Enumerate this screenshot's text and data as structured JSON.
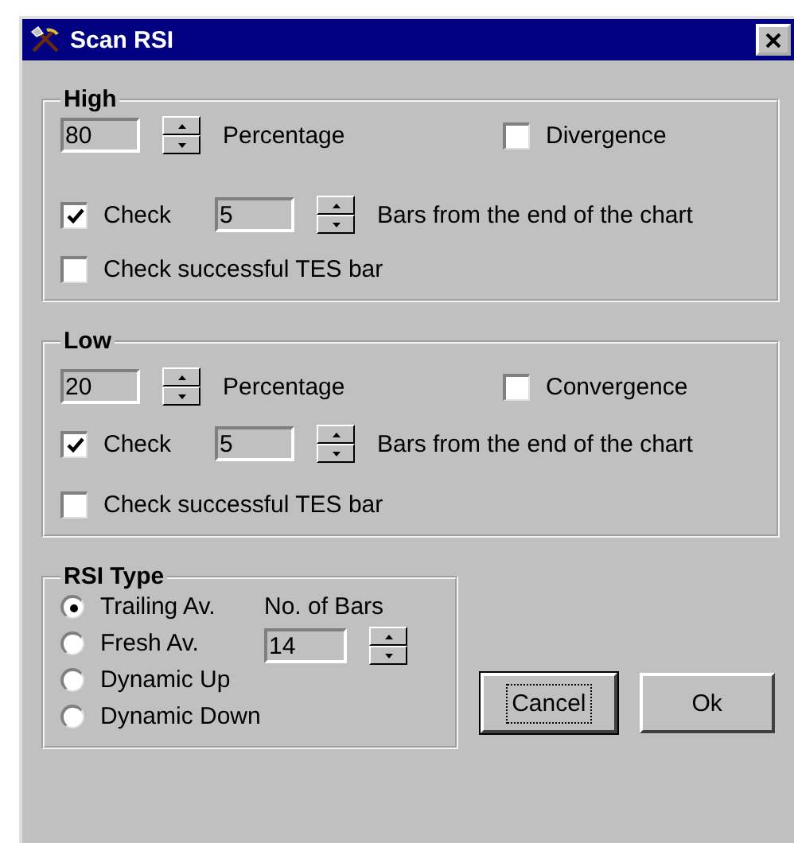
{
  "window": {
    "title": "Scan RSI"
  },
  "groups": [
    {
      "title": "High",
      "percentage": "80",
      "percentage_label": "Percentage",
      "option": {
        "label": "Divergence",
        "checked": false
      },
      "check": {
        "label": "Check",
        "checked": true
      },
      "bars": "5",
      "bars_label": "Bars from the end of the chart",
      "tes": {
        "label": "Check successful TES bar",
        "checked": false
      }
    },
    {
      "title": "Low",
      "percentage": "20",
      "percentage_label": "Percentage",
      "option": {
        "label": "Convergence",
        "checked": false
      },
      "check": {
        "label": "Check",
        "checked": true
      },
      "bars": "5",
      "bars_label": "Bars from the end of the chart",
      "tes": {
        "label": "Check successful TES bar",
        "checked": false
      }
    }
  ],
  "rsi_type": {
    "title": "RSI Type",
    "options": [
      {
        "label": "Trailing Av.",
        "selected": true
      },
      {
        "label": "Fresh Av.",
        "selected": false
      },
      {
        "label": "Dynamic Up",
        "selected": false
      },
      {
        "label": "Dynamic Down",
        "selected": false
      }
    ],
    "bars_label": "No. of Bars",
    "bars": "14"
  },
  "buttons": [
    {
      "label": "Cancel",
      "focused": true
    },
    {
      "label": "Ok",
      "focused": false
    }
  ]
}
